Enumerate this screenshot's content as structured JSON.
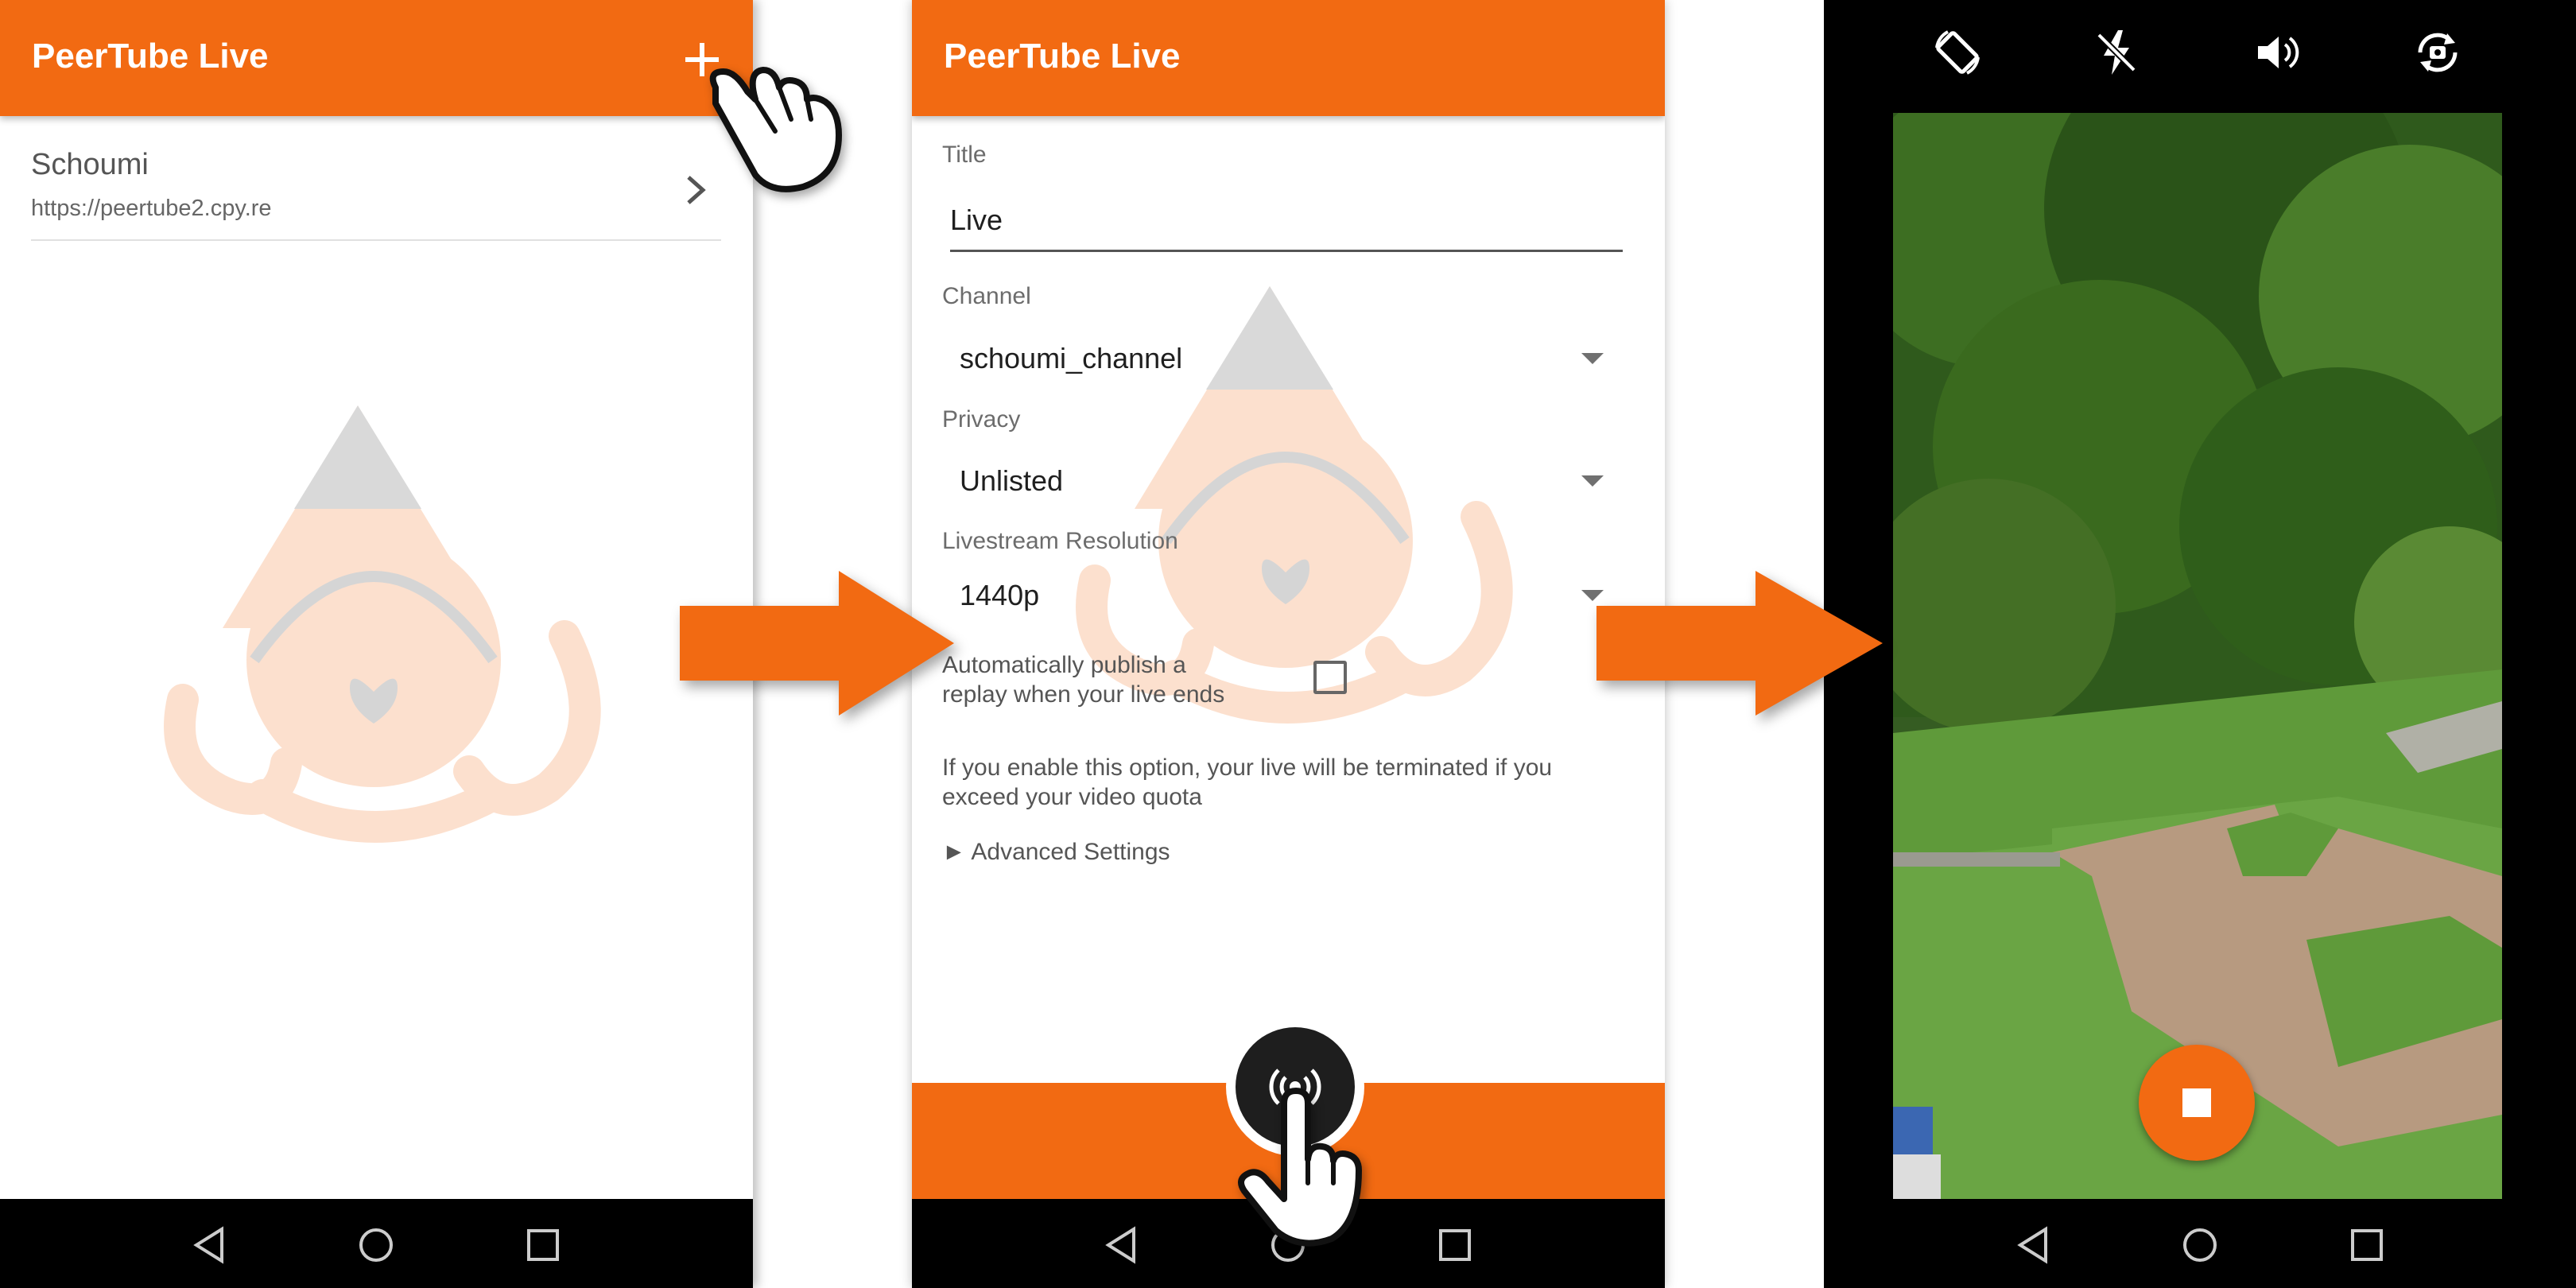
{
  "screen1": {
    "app_title": "PeerTube Live",
    "add_icon": "plus-icon",
    "server": {
      "name": "Schoumi",
      "url": "https://peertube2.cpy.re"
    }
  },
  "screen2": {
    "app_title": "PeerTube Live",
    "title_label": "Title",
    "title_value": "Live",
    "channel_label": "Channel",
    "channel_value": "schoumi_channel",
    "privacy_label": "Privacy",
    "privacy_value": "Unlisted",
    "resolution_label": "Livestream Resolution",
    "resolution_value": "1440p",
    "replay_label_line1": "Automatically publish a",
    "replay_label_line2": "replay when your live ends",
    "replay_checked": false,
    "info_line1": "If you enable this option, your live will be terminated if you",
    "info_line2": "exceed your video quota",
    "advanced_settings": "► Advanced Settings",
    "go_live_icon": "broadcast-icon"
  },
  "screen3": {
    "controls": [
      "rotate-screen-icon",
      "flash-off-icon",
      "volume-icon",
      "switch-camera-icon"
    ],
    "stop_icon": "stop-icon"
  },
  "colors": {
    "accent": "#f26a12",
    "navbar": "#000000",
    "fab_dark": "#1e1e1e"
  }
}
